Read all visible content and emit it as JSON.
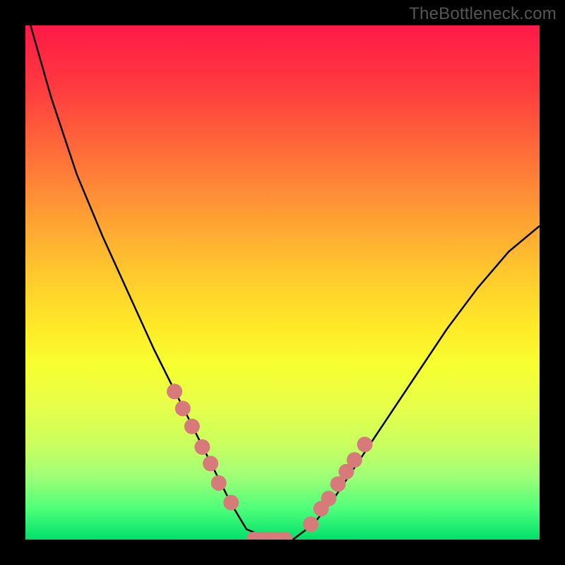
{
  "watermark": "TheBottleneck.com",
  "chart_data": {
    "type": "line",
    "title": "",
    "xlabel": "",
    "ylabel": "",
    "xlim": [
      0,
      1
    ],
    "ylim": [
      0,
      1
    ],
    "series": [
      {
        "name": "curve",
        "x": [
          0.01,
          0.05,
          0.1,
          0.15,
          0.2,
          0.25,
          0.28,
          0.31,
          0.34,
          0.37,
          0.4,
          0.43,
          0.48,
          0.52,
          0.56,
          0.6,
          0.64,
          0.7,
          0.76,
          0.82,
          0.88,
          0.94,
          1.0
        ],
        "values": [
          1.0,
          0.86,
          0.71,
          0.59,
          0.48,
          0.37,
          0.31,
          0.25,
          0.19,
          0.13,
          0.07,
          0.02,
          0.0,
          0.0,
          0.03,
          0.08,
          0.14,
          0.23,
          0.32,
          0.41,
          0.49,
          0.56,
          0.61
        ]
      }
    ],
    "left_markers": {
      "x": [
        0.29,
        0.306,
        0.324,
        0.344,
        0.36,
        0.376,
        0.4
      ],
      "values": [
        0.288,
        0.255,
        0.22,
        0.18,
        0.148,
        0.11,
        0.072
      ]
    },
    "right_markers": {
      "x": [
        0.555,
        0.575,
        0.59,
        0.608,
        0.624,
        0.64,
        0.66
      ],
      "values": [
        0.03,
        0.06,
        0.08,
        0.108,
        0.132,
        0.155,
        0.185
      ]
    },
    "flat_segment": {
      "x_start": 0.43,
      "x_end": 0.52,
      "value": 0.0
    },
    "colors": {
      "curve": "#000000",
      "markers": "#d77a7a",
      "flat": "#d77a7a"
    }
  }
}
